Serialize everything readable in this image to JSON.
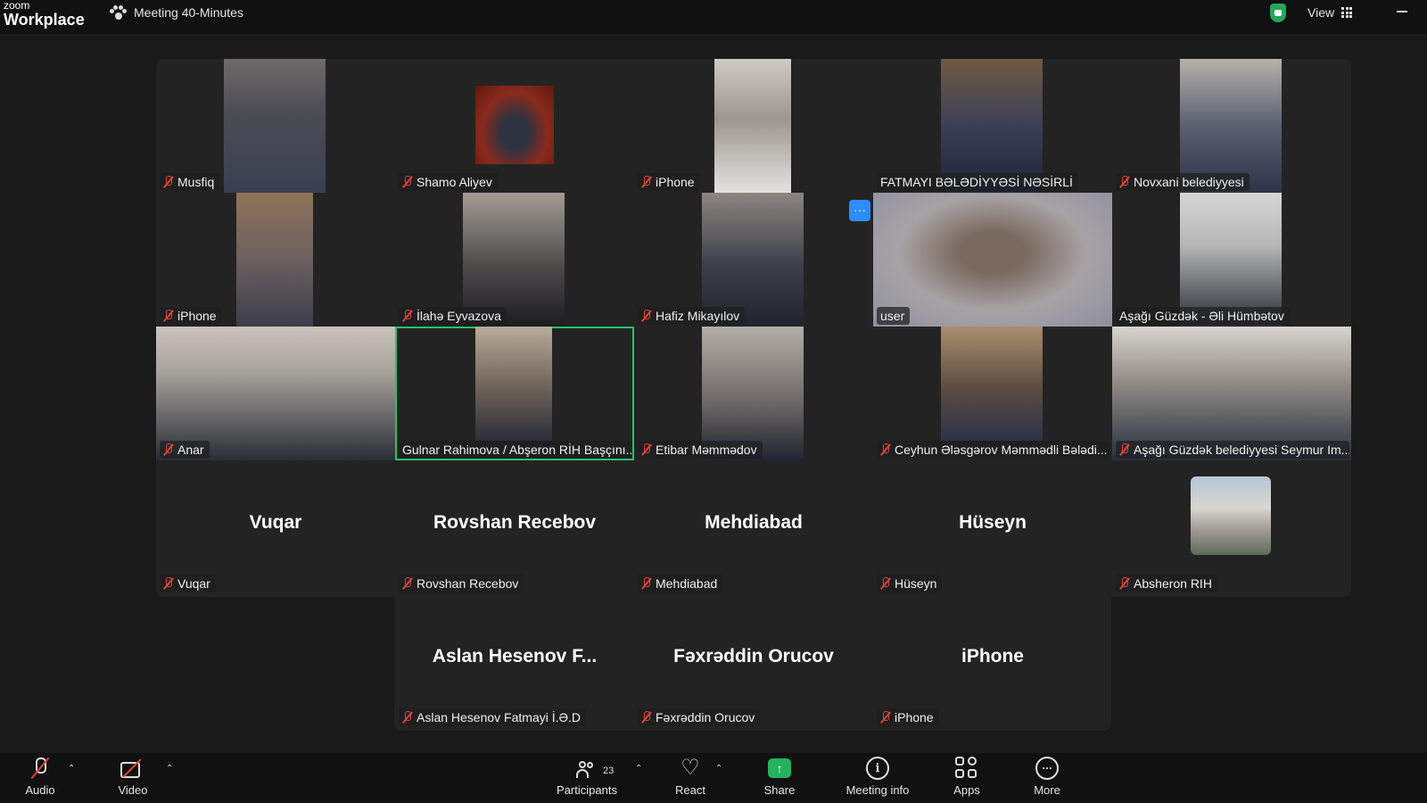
{
  "app": {
    "logo_small": "zoom",
    "logo_big": "Workplace",
    "meeting_title": "Meeting 40-Minutes",
    "view_label": "View"
  },
  "tiles": [
    {
      "name": "Musfiq"
    },
    {
      "name": "Shamo Aliyev"
    },
    {
      "name": "iPhone"
    },
    {
      "name": "FATMAYI BƏLƏDİYYƏSİ NƏSİRLİ"
    },
    {
      "name": "Novxani belediyyesi"
    },
    {
      "name": "iPhone"
    },
    {
      "name": "İlahə Eyvazova"
    },
    {
      "name": "Hafiz Mikayılov"
    },
    {
      "name": "user"
    },
    {
      "name": "Aşağı Güzdək - Əli Hümbətov"
    },
    {
      "name": "Anar"
    },
    {
      "name": "Gulnar Rahimova / Abşeron RİH Başçını..."
    },
    {
      "name": "Etibar Məmmədov"
    },
    {
      "name": "Ceyhun Ələsgərov Məmmədli Bələdi..."
    },
    {
      "name": "Aşağı Güzdək belediyyesi Seymur Im..."
    },
    {
      "name": "Vuqar",
      "display": "Vuqar"
    },
    {
      "name": "Rovshan Recebov",
      "display": "Rovshan Recebov"
    },
    {
      "name": "Mehdiabad",
      "display": "Mehdiabad"
    },
    {
      "name": "Hüseyn",
      "display": "Hüseyn"
    },
    {
      "name": "Absheron RIH"
    },
    {
      "name": "Aslan Hesenov Fatmayi İ.Ə.D",
      "display": "Aslan Hesenov F..."
    },
    {
      "name": "Fəxrəddin Orucov",
      "display": "Fəxrəddin Orucov"
    },
    {
      "name": "iPhone",
      "display": "iPhone"
    }
  ],
  "more_button": "···",
  "toolbar": {
    "audio": "Audio",
    "video": "Video",
    "participants": "Participants",
    "participants_count": "23",
    "react": "React",
    "share": "Share",
    "meeting_info": "Meeting info",
    "apps": "Apps",
    "more": "More"
  },
  "icons": [
    "paw-icon",
    "shield-icon",
    "grid-icon",
    "mic-off-icon",
    "video-off-icon",
    "participants-icon",
    "heart-icon",
    "share-icon",
    "info-icon",
    "apps-icon",
    "more-icon"
  ],
  "colors": {
    "active_speaker": "#26c26e",
    "share_green": "#23b35e",
    "muted_red": "#e0453a",
    "accent_blue": "#2d8cff"
  }
}
